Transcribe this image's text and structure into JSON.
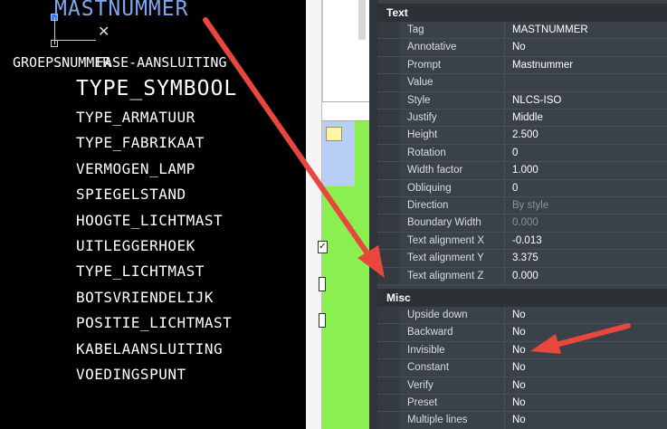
{
  "cad": {
    "title": "MASTNUMMER",
    "groep": "GROEPSNUMMER",
    "aansluiting": "FASE-AANSLUITING",
    "symbool": "TYPE_SYMBOOL",
    "attributes": [
      "TYPE_ARMATUUR",
      "TYPE_FABRIKAAT",
      "VERMOGEN_LAMP",
      "SPIEGELSTAND",
      "HOOGTE_LICHTMAST",
      "UITLEGGERHOEK",
      "TYPE_LICHTMAST",
      "BOTSVRIENDELIJK",
      "POSITIE_LICHTMAST",
      "KABELAANSLUITING",
      "VOEDINGSPUNT"
    ]
  },
  "properties": {
    "text_section": "Text",
    "text_rows": [
      {
        "label": "Tag",
        "value": "MASTNUMMER"
      },
      {
        "label": "Annotative",
        "value": "No"
      },
      {
        "label": "Prompt",
        "value": "Mastnummer"
      },
      {
        "label": "Value",
        "value": ""
      },
      {
        "label": "Style",
        "value": "NLCS-ISO"
      },
      {
        "label": "Justify",
        "value": "Middle"
      },
      {
        "label": "Height",
        "value": "2.500"
      },
      {
        "label": "Rotation",
        "value": "0"
      },
      {
        "label": "Width factor",
        "value": "1.000"
      },
      {
        "label": "Obliquing",
        "value": "0"
      },
      {
        "label": "Direction",
        "value": "By style",
        "dim": true
      },
      {
        "label": "Boundary Width",
        "value": "0.000",
        "dim": true
      },
      {
        "label": "Text alignment X",
        "value": "-0.013"
      },
      {
        "label": "Text alignment Y",
        "value": "3.375"
      },
      {
        "label": "Text alignment Z",
        "value": "0.000"
      }
    ],
    "misc_section": "Misc",
    "misc_rows": [
      {
        "label": "Upside down",
        "value": "No"
      },
      {
        "label": "Backward",
        "value": "No"
      },
      {
        "label": "Invisible",
        "value": "No"
      },
      {
        "label": "Constant",
        "value": "No"
      },
      {
        "label": "Verify",
        "value": "No"
      },
      {
        "label": "Preset",
        "value": "No"
      },
      {
        "label": "Multiple lines",
        "value": "No"
      }
    ]
  },
  "colors": {
    "arrow": "#e8473e",
    "cad_highlight": "#7ea6ec",
    "panel_bg": "#3b4148"
  }
}
